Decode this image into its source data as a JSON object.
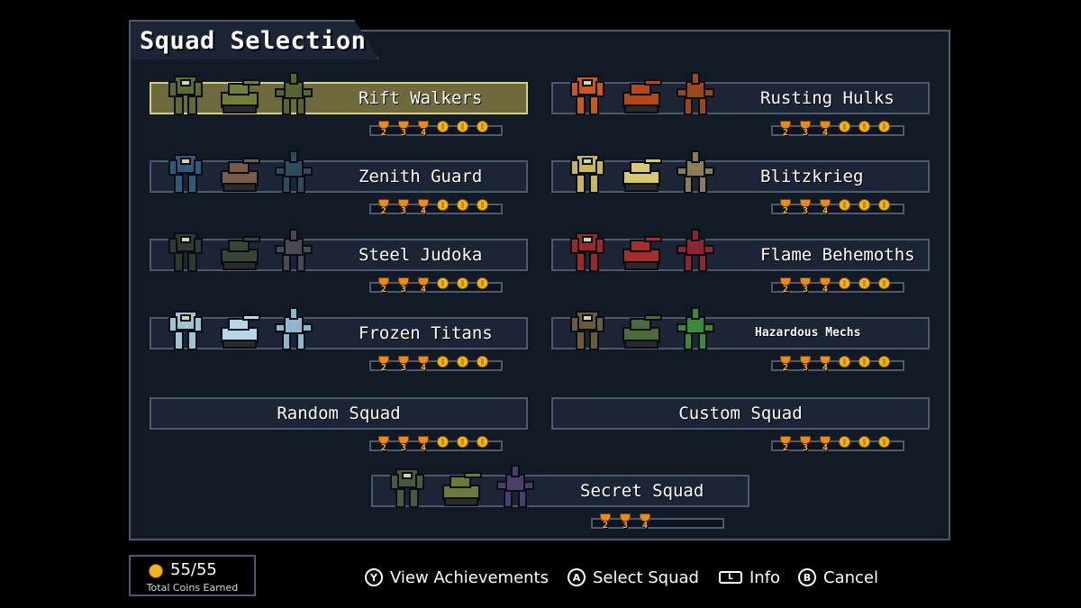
{
  "title": "Squad Selection",
  "squads": [
    {
      "id": "rift-walkers",
      "name": "Rift Walkers",
      "selected": true,
      "colors": [
        "#5b6b32",
        "#6f7f3a",
        "#56652f"
      ],
      "trophies": [
        "2",
        "3",
        "4"
      ],
      "coins": 3
    },
    {
      "id": "rusting-hulks",
      "name": "Rusting Hulks",
      "selected": false,
      "colors": [
        "#c65a1e",
        "#b4481c",
        "#9a4a1a"
      ],
      "trophies": [
        "2",
        "3",
        "4"
      ],
      "coins": 3
    },
    {
      "id": "zenith-guard",
      "name": "Zenith Guard",
      "selected": false,
      "colors": [
        "#2f5a7a",
        "#7a5a4a",
        "#2f4c5e"
      ],
      "trophies": [
        "2",
        "3",
        "4"
      ],
      "coins": 3
    },
    {
      "id": "blitzkrieg",
      "name": "Blitzkrieg",
      "selected": false,
      "colors": [
        "#c9b55a",
        "#d8c870",
        "#8a7e55"
      ],
      "trophies": [
        "2",
        "3",
        "4"
      ],
      "coins": 3
    },
    {
      "id": "steel-judoka",
      "name": "Steel Judoka",
      "selected": false,
      "colors": [
        "#2e3a2e",
        "#3a4634",
        "#4a4a52"
      ],
      "trophies": [
        "2",
        "3",
        "4"
      ],
      "coins": 3
    },
    {
      "id": "flame-behemoths",
      "name": "Flame Behemoths",
      "selected": false,
      "colors": [
        "#9a2a2a",
        "#a32e2e",
        "#8c2630"
      ],
      "trophies": [
        "2",
        "3",
        "4"
      ],
      "coins": 3
    },
    {
      "id": "frozen-titans",
      "name": "Frozen Titans",
      "selected": false,
      "colors": [
        "#9ec4d8",
        "#b4d8e6",
        "#8fb6cc"
      ],
      "trophies": [
        "2",
        "3",
        "4"
      ],
      "coins": 3
    },
    {
      "id": "hazardous-mechs",
      "name": "Hazardous Mechs",
      "selected": false,
      "colors": [
        "#6a5a3e",
        "#4f6a3a",
        "#3a8a3a"
      ],
      "trophies": [
        "2",
        "3",
        "4"
      ],
      "coins": 3
    },
    {
      "id": "random-squad",
      "name": "Random Squad",
      "selected": false,
      "colors": [],
      "trophies": [
        "2",
        "3",
        "4"
      ],
      "coins": 3
    },
    {
      "id": "custom-squad",
      "name": "Custom Squad",
      "selected": false,
      "colors": [],
      "trophies": [
        "2",
        "3",
        "4"
      ],
      "coins": 3
    },
    {
      "id": "secret-squad",
      "name": "Secret Squad",
      "selected": false,
      "colors": [
        "#4a5a3e",
        "#6a7a3a",
        "#4a3e6a"
      ],
      "trophies": [
        "2",
        "3",
        "4"
      ],
      "coins": 0
    }
  ],
  "footer": {
    "coins": "55/55",
    "coins_label": "Total Coins Earned",
    "hints": [
      {
        "key": "Y",
        "label": "View Achievements"
      },
      {
        "key": "A",
        "label": "Select Squad"
      },
      {
        "key": "L",
        "label": "Info"
      },
      {
        "key": "B",
        "label": "Cancel"
      }
    ]
  }
}
